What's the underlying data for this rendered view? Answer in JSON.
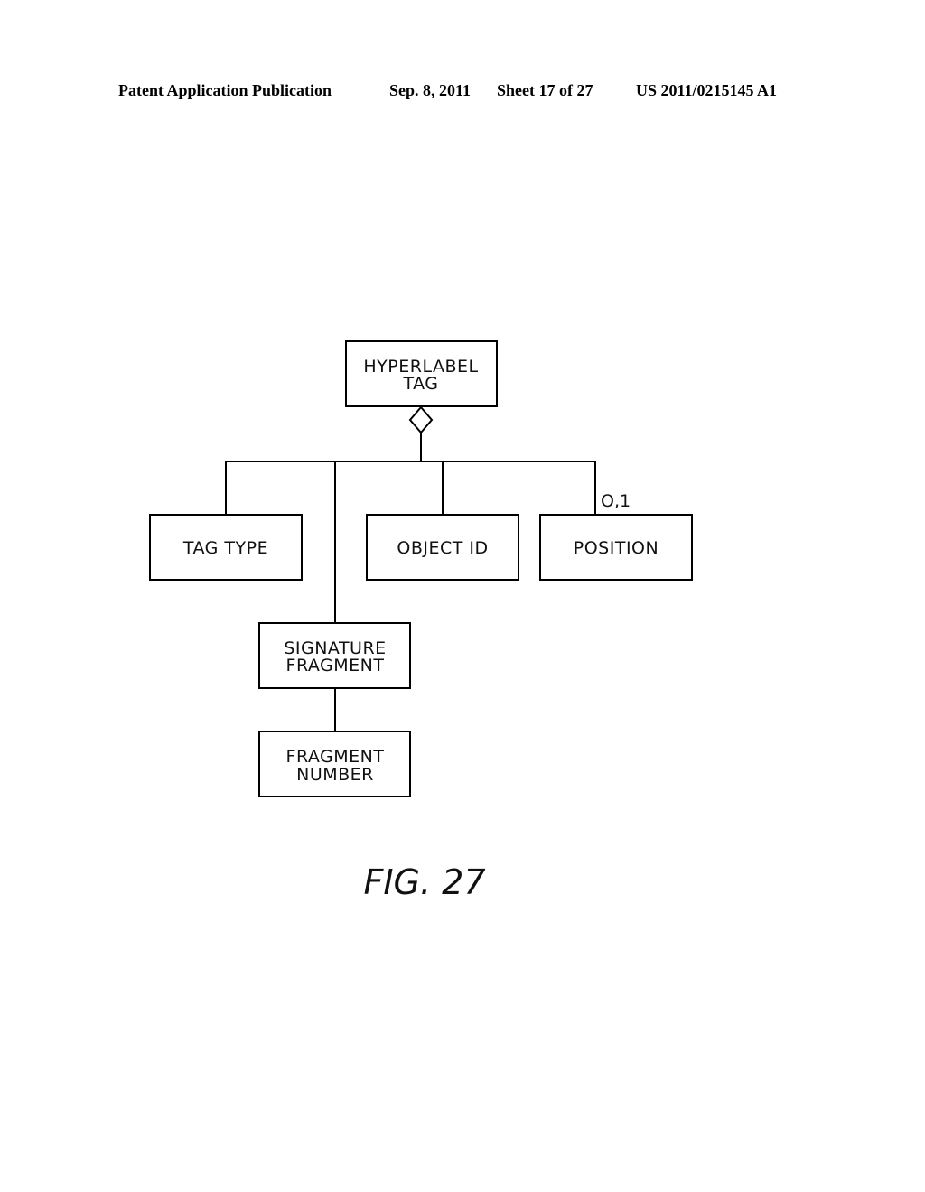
{
  "header": {
    "publication": "Patent Application Publication",
    "date": "Sep. 8, 2011",
    "sheet": "Sheet 17 of 27",
    "number": "US 2011/0215145 A1"
  },
  "diagram": {
    "root": {
      "line1": "HYPERLABEL",
      "line2": "TAG",
      "connector": "aggregation-diamond"
    },
    "children": [
      {
        "id": "tag-type",
        "line1": "TAG TYPE"
      },
      {
        "id": "signature-fragment",
        "line1": "SIGNATURE",
        "line2": "FRAGMENT"
      },
      {
        "id": "object-id",
        "line1": "OBJECT ID"
      },
      {
        "id": "position",
        "line1": "POSITION",
        "multiplicity": "O,1"
      }
    ],
    "grandchild": {
      "parent": "signature-fragment",
      "line1": "FRAGMENT",
      "line2": "NUMBER"
    },
    "figure_label": "FIG. 27"
  }
}
